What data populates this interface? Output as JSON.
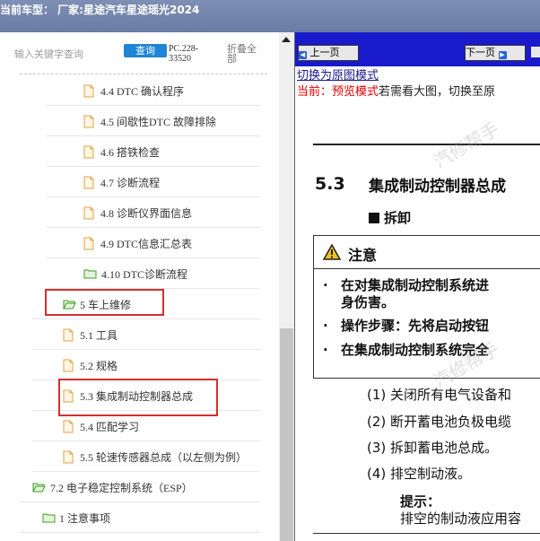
{
  "header": {
    "title": "当前车型： 厂家:星途汽车星途瑶光2024"
  },
  "sidebar": {
    "search_placeholder": "输入关键字查询",
    "query_button": "查询",
    "code_line1": "PC.228-",
    "code_line2": "33520",
    "collapse_line1": "折叠全",
    "collapse_line2": "部",
    "items": [
      {
        "label": "4.4 DTC 确认程序"
      },
      {
        "label": "4.5 间歇性DTC 故障排除"
      },
      {
        "label": "4.6 搭铁检查"
      },
      {
        "label": "4.7 诊断流程"
      },
      {
        "label": "4.8 诊断仪界面信息"
      },
      {
        "label": "4.9 DTC信息汇总表"
      },
      {
        "label": "4.10 DTC诊断流程"
      },
      {
        "label": "5 车上维修"
      },
      {
        "label": "5.1 工具"
      },
      {
        "label": "5.2 规格"
      },
      {
        "label": "5.3 集成制动控制器总成"
      },
      {
        "label": "5.4 匹配学习"
      },
      {
        "label": "5.5 轮速传感器总成（以左侧为例）"
      },
      {
        "label": "7.2 电子稳定控制系统（ESP）"
      },
      {
        "label": "1 注意事项"
      }
    ]
  },
  "viewer": {
    "prev_button": "上一页",
    "next_button": "下一页",
    "switch_link": "切换为原图模式",
    "current_prefix": "当前：",
    "current_mode": "预览模式",
    "current_suffix": "若需看大图，切换至原",
    "section_number": "5.3",
    "section_title": "集成制动控制器总成",
    "subheading": "拆卸",
    "warning_title": "注意",
    "warnings": [
      "在对集成制动控制系统进",
      "身伤害。",
      "操作步骤：先将启动按钮",
      "在集成制动控制系统完全"
    ],
    "steps": [
      "(1)  关闭所有电气设备和",
      "(2)  断开蓄电池负极电缆",
      "(3)  拆卸蓄电池总成。",
      "(4)  排空制动液。"
    ],
    "hint_title": "提示：",
    "hint_text": "排空的制动液应用容",
    "watermark": "汽修帮手"
  },
  "colors": {
    "highlight": "#d62f2f",
    "nav_bar": "#1a1acd",
    "query_button": "#1f85d4"
  }
}
